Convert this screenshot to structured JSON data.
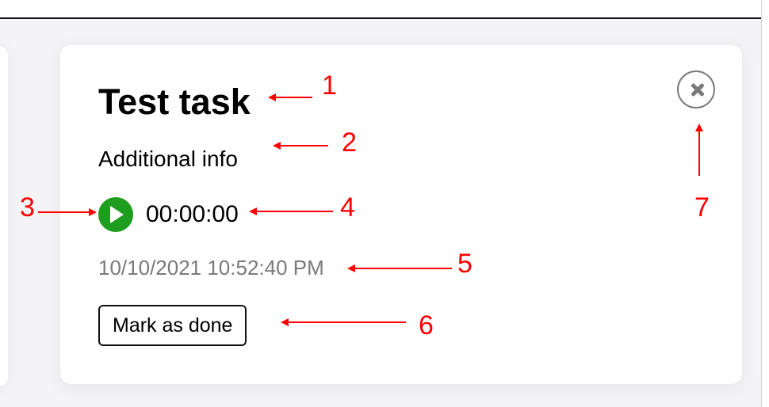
{
  "task": {
    "title": "Test task",
    "info": "Additional info",
    "timer": "00:00:00",
    "created_at": "10/10/2021 10:52:40 PM",
    "done_label": "Mark as done"
  },
  "icons": {
    "play": "play-icon",
    "close": "close-icon"
  },
  "colors": {
    "play_button": "#1f9d1f",
    "timestamp_text": "#7a7a7a",
    "annotation": "#ff0000"
  },
  "annotations": [
    "1",
    "2",
    "3",
    "4",
    "5",
    "6",
    "7"
  ]
}
